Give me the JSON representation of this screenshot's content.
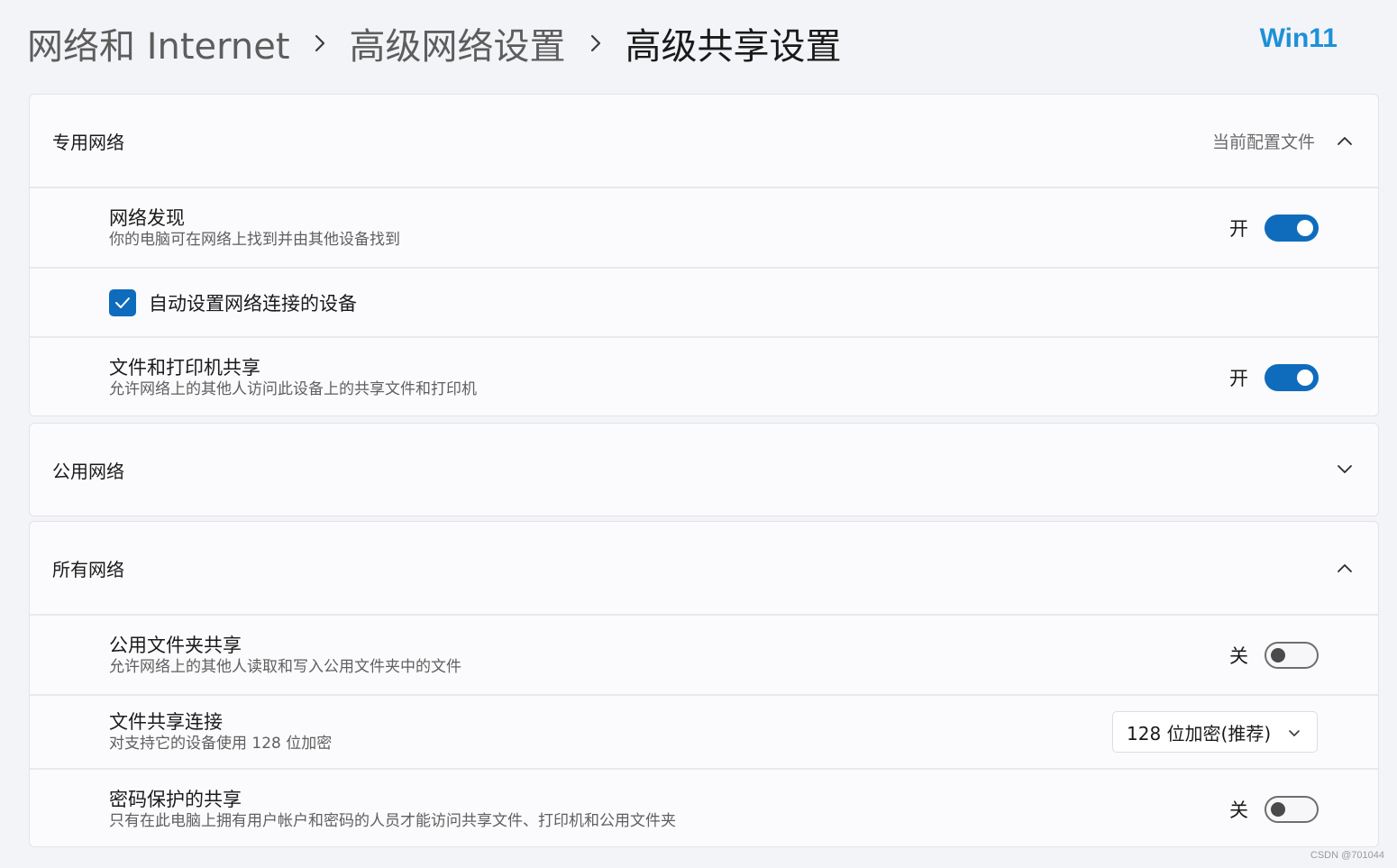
{
  "breadcrumb": {
    "items": [
      "网络和 Internet",
      "高级网络设置",
      "高级共享设置"
    ]
  },
  "brand": "Win11",
  "sections": {
    "private": {
      "title": "专用网络",
      "status": "当前配置文件",
      "expanded": true,
      "network_discovery": {
        "title": "网络发现",
        "desc": "你的电脑可在网络上找到并由其他设备找到",
        "state": "开"
      },
      "auto_setup": {
        "label": "自动设置网络连接的设备",
        "checked": true
      },
      "file_printer_sharing": {
        "title": "文件和打印机共享",
        "desc": "允许网络上的其他人访问此设备上的共享文件和打印机",
        "state": "开"
      }
    },
    "public": {
      "title": "公用网络",
      "expanded": false
    },
    "all": {
      "title": "所有网络",
      "expanded": true,
      "public_folder_sharing": {
        "title": "公用文件夹共享",
        "desc": "允许网络上的其他人读取和写入公用文件夹中的文件",
        "state": "关"
      },
      "file_sharing_connection": {
        "title": "文件共享连接",
        "desc": "对支持它的设备使用 128 位加密",
        "selected": "128 位加密(推荐)"
      },
      "password_protected_sharing": {
        "title": "密码保护的共享",
        "desc": "只有在此电脑上拥有用户帐户和密码的人员才能访问共享文件、打印机和公用文件夹",
        "state": "关"
      }
    }
  },
  "watermark": "CSDN @701044",
  "colors": {
    "accent": "#0f6cbd",
    "brand": "#1e90d8",
    "background": "#f3f4f7",
    "card": "#fbfbfd"
  }
}
